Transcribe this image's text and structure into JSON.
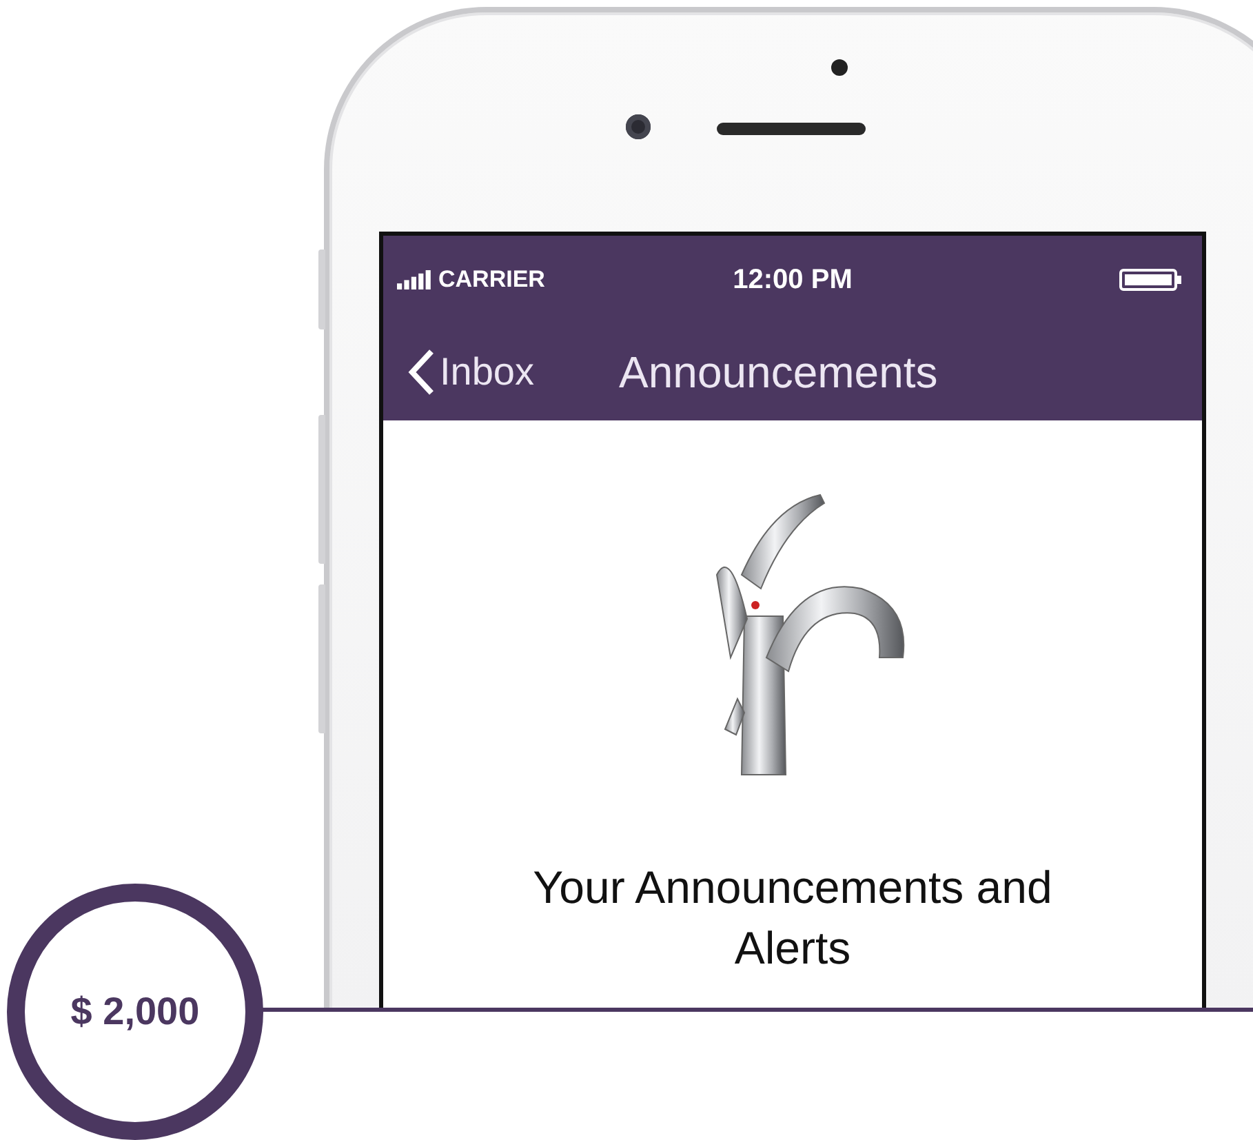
{
  "status_bar": {
    "carrier": "CARRIER",
    "time": "12:00 PM"
  },
  "nav_bar": {
    "back_label": "Inbox",
    "title": "Announcements"
  },
  "content": {
    "heading": "Your Announcements and Alerts"
  },
  "price_badge": {
    "amount": "$ 2,000"
  }
}
